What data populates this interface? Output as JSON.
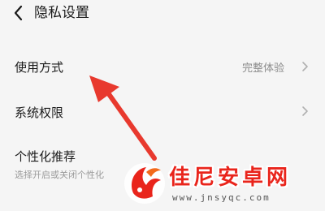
{
  "header": {
    "title": "隐私设置",
    "back_icon": "chevron-left-icon"
  },
  "settings": {
    "usage_mode": {
      "label": "使用方式",
      "value": "完整体验",
      "icon": "chevron-right-icon"
    },
    "system_permissions": {
      "label": "系统权限",
      "icon": "chevron-right-icon"
    },
    "personalized_recommend": {
      "label": "个性化推荐",
      "description": "选择开启或关闭个性化"
    }
  },
  "annotation": {
    "arrow_color": "#e8392e",
    "icon": "red-arrow-icon"
  },
  "watermark": {
    "title": "佳尼安卓网",
    "url": "www.jnsyqc.com",
    "color": "#e9241b"
  }
}
